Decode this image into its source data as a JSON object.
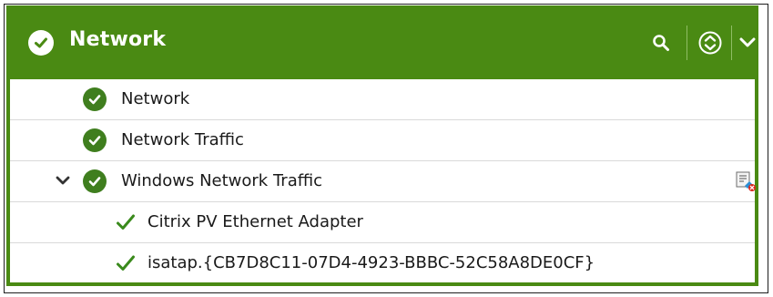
{
  "colors": {
    "header_bg": "#4a8a13",
    "status_ok": "#3f7e1e",
    "tick": "#3a8a1c"
  },
  "header": {
    "title": "Network",
    "status_icon": "check-circle-icon",
    "actions": [
      {
        "name": "search",
        "icon": "search-icon"
      },
      {
        "name": "sort",
        "icon": "sort-updown-icon"
      },
      {
        "name": "collapse",
        "icon": "chevron-down-icon"
      }
    ]
  },
  "tree": {
    "rows": [
      {
        "label": "Network",
        "status": "ok",
        "level": 0
      },
      {
        "label": "Network Traffic",
        "status": "ok",
        "level": 0
      },
      {
        "label": "Windows Network Traffic",
        "status": "ok",
        "level": 0,
        "expanded": true,
        "has_action_icon": true,
        "action_icon": "configure-icon"
      },
      {
        "label": "Citrix PV Ethernet Adapter",
        "status": "ok",
        "level": 1
      },
      {
        "label": "isatap.{CB7D8C11-07D4-4923-BBBC-52C58A8DE0CF}",
        "status": "ok",
        "level": 1
      }
    ]
  }
}
